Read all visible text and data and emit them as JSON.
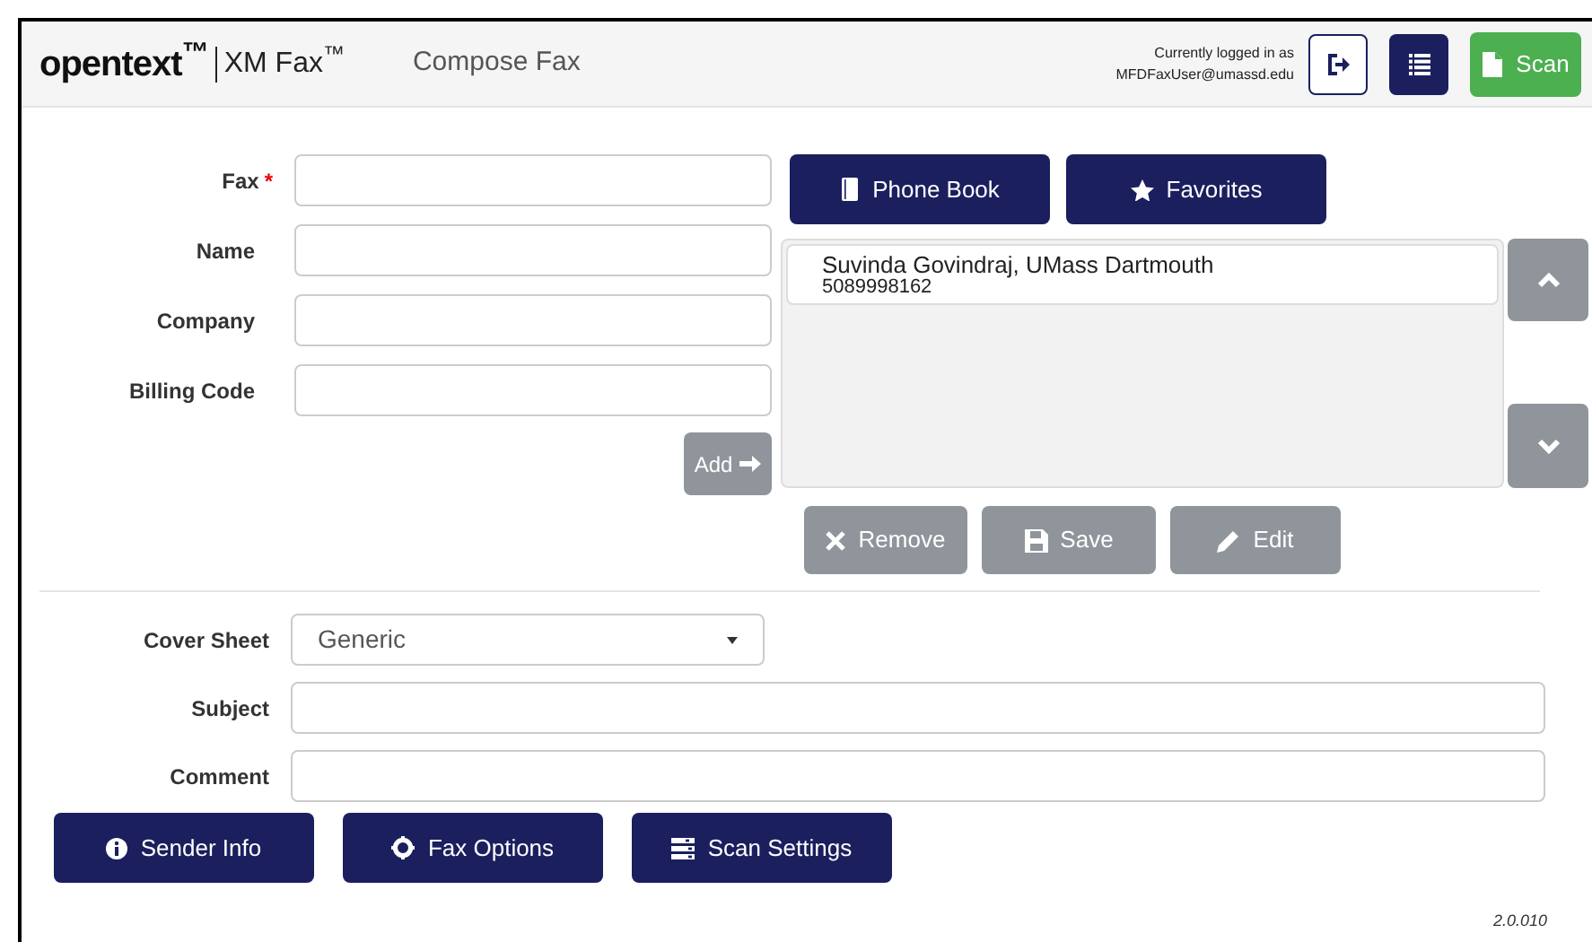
{
  "header": {
    "brand": "opentext$^{™}$",
    "product": "XM Fax$^{™}$",
    "page_title": "Compose Fax",
    "login_label": "Currently logged in as",
    "user": "MFDFaxUser@umassd.edu",
    "scan_button": "Scan"
  },
  "recipient_fields": [
    {
      "label": "Fax",
      "required": true
    },
    {
      "label": "Name",
      "required": false
    },
    {
      "label": "Company",
      "required": false
    },
    {
      "label": "Billing Code",
      "required": false
    }
  ],
  "required_mark": "*",
  "add_button": "Add",
  "lookup_buttons": [
    {
      "kind": "phonebook",
      "label": "Phone Book"
    },
    {
      "kind": "favorites",
      "label": "Favorites"
    }
  ],
  "recipients": [
    {
      "name": "Suvinda Govindraj, UMass Dartmouth",
      "number": "5089998162"
    }
  ],
  "list_buttons": [
    {
      "kind": "remove",
      "label": "Remove"
    },
    {
      "kind": "save",
      "label": "Save"
    },
    {
      "kind": "edit",
      "label": "Edit"
    }
  ],
  "cover_sheet": {
    "label": "Cover Sheet",
    "value": "Generic"
  },
  "message_fields": [
    {
      "label": "Subject"
    },
    {
      "label": "Comment"
    }
  ],
  "bottom_buttons": [
    {
      "kind": "info",
      "label": "Sender Info"
    },
    {
      "kind": "gear",
      "label": "Fax Options"
    },
    {
      "kind": "settings",
      "label": "Scan Settings"
    }
  ],
  "version": "2.0.010"
}
